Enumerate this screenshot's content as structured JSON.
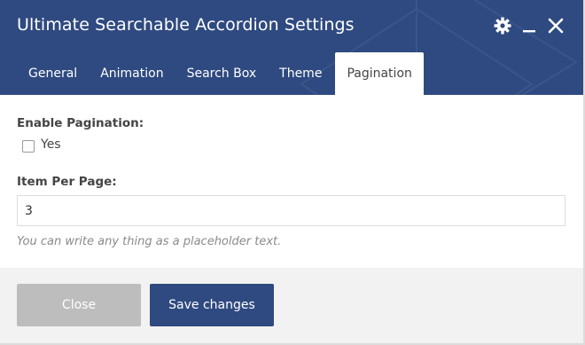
{
  "dialog": {
    "title": "Ultimate Searchable Accordion Settings",
    "header_icons": [
      "gear-icon",
      "minimize-icon",
      "close-icon"
    ],
    "colors": {
      "header_bg": "#2f4a80",
      "primary_button": "#2f4a80",
      "disabled_button": "#bdbdbd",
      "footer_bg": "#f2f2f2"
    }
  },
  "tabs": [
    {
      "label": "General",
      "active": false
    },
    {
      "label": "Animation",
      "active": false
    },
    {
      "label": "Search Box",
      "active": false
    },
    {
      "label": "Theme",
      "active": false
    },
    {
      "label": "Pagination",
      "active": true
    }
  ],
  "form": {
    "pagination": {
      "label": "Enable Pagination:",
      "option_label": "Yes",
      "checked": false
    },
    "item_per_page": {
      "label": "Item Per Page:",
      "value": "3",
      "hint": "You can write any thing as a placeholder text."
    }
  },
  "footer": {
    "close_label": "Close",
    "save_label": "Save changes"
  }
}
